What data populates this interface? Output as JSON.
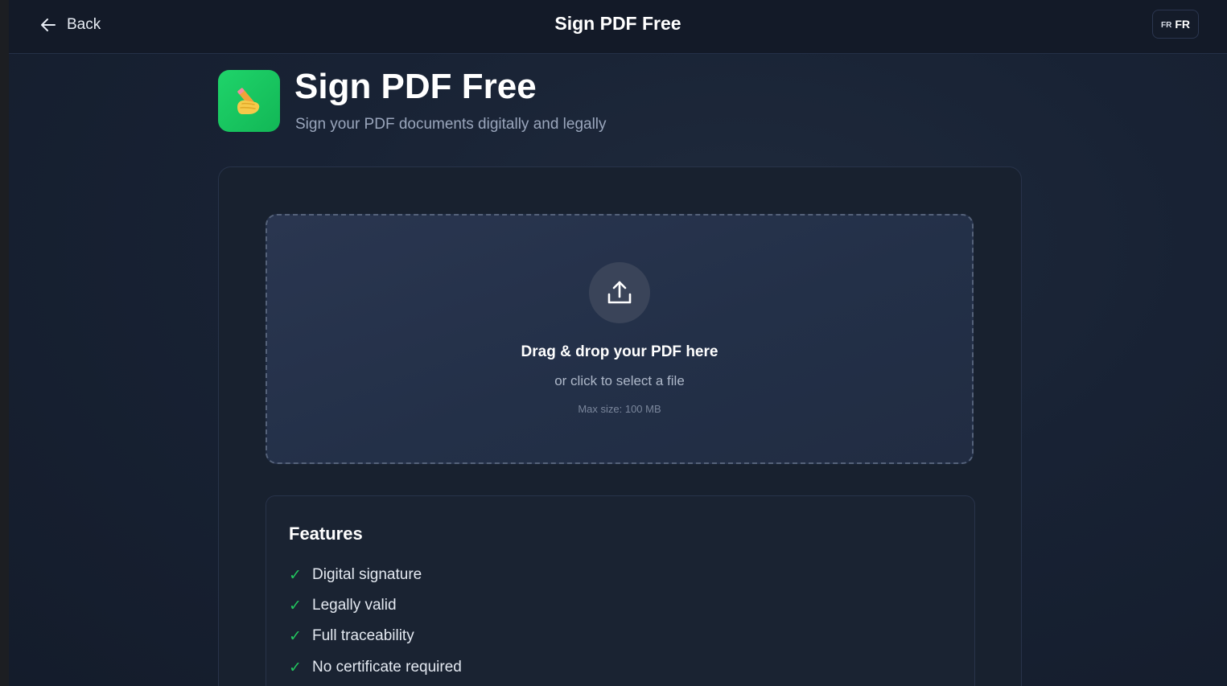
{
  "header": {
    "back_label": "Back",
    "title": "Sign PDF Free",
    "language": {
      "flag": "FR",
      "code": "FR"
    }
  },
  "hero": {
    "icon": "writing-hand-icon",
    "title": "Sign PDF Free",
    "subtitle": "Sign your PDF documents digitally and legally"
  },
  "dropzone": {
    "icon": "upload-icon",
    "title": "Drag & drop your PDF here",
    "subtitle": "or click to select a file",
    "max_size": "Max size: 100 MB"
  },
  "features": {
    "title": "Features",
    "items": [
      {
        "check": "✓",
        "label": "Digital signature"
      },
      {
        "check": "✓",
        "label": "Legally valid"
      },
      {
        "check": "✓",
        "label": "Full traceability"
      },
      {
        "check": "✓",
        "label": "No certificate required"
      }
    ]
  },
  "colors": {
    "accent_green": "#22c55e",
    "background": "#141b2a"
  }
}
